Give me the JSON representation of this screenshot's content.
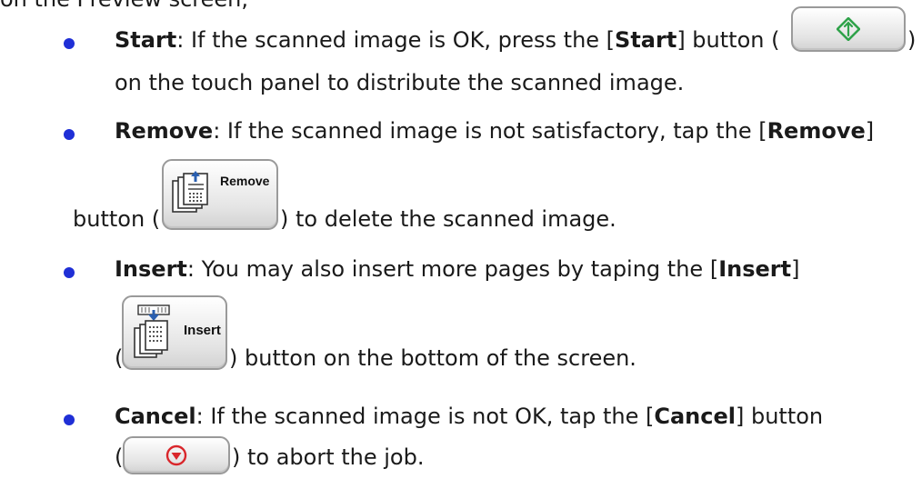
{
  "intro": {
    "text": "on the Preview screen,",
    "color": "#1a1a1a"
  },
  "bullet_color": "#1f2fd6",
  "items": [
    {
      "term": "Start",
      "line1_pre": ": If the scanned image is OK, press the [",
      "line1_term": "Start",
      "line1_post": "] button (",
      "line1_close": ")",
      "line2": "on the touch panel to distribute the scanned image.",
      "icon": "start-diamond-icon",
      "icon_color": "#2fa24a"
    },
    {
      "term": "Remove",
      "line1_pre": ": If the scanned image is not satisfactory, tap the [",
      "line1_term": "Remove",
      "line1_post": "]",
      "line2_pre": "button (",
      "line2_post": ") to delete the scanned image.",
      "button_label": "Remove",
      "icon": "remove-pages-icon"
    },
    {
      "term": "Insert",
      "line1_pre": ": You may also insert more pages by taping the [",
      "line1_term": "Insert",
      "line1_post": "]",
      "line2_pre": "(",
      "line2_post": ") button on the bottom of the screen.",
      "button_label": "Insert",
      "icon": "insert-pages-icon"
    },
    {
      "term": "Cancel",
      "line1_pre": ": If the scanned image is not OK, tap the [",
      "line1_term": "Cancel",
      "line1_post": "] button",
      "line2_pre": "(",
      "line2_post": ") to abort the job.",
      "icon": "cancel-stop-icon",
      "icon_color": "#d9262b"
    }
  ]
}
